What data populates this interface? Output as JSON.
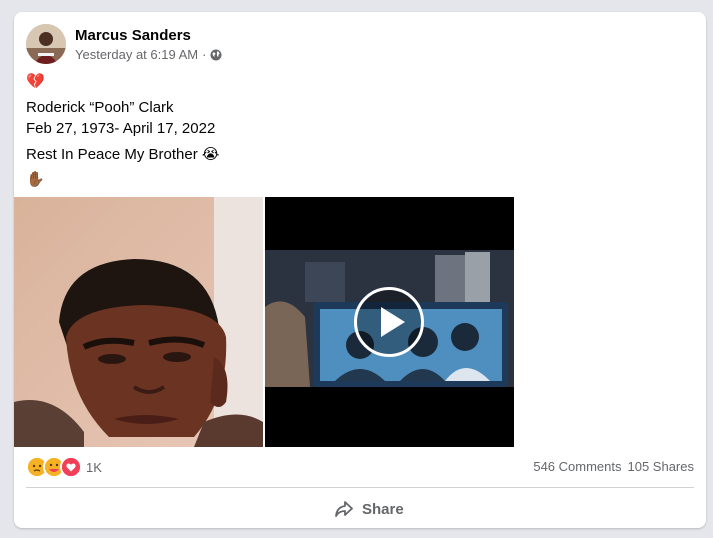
{
  "post": {
    "author": "Marcus Sanders",
    "timestamp": "Yesterday at 6:19 AM",
    "separator": "·",
    "audience_icon": "globe-icon",
    "lines": [
      "💔",
      "Roderick “Pooh” Clark",
      "Feb 27, 1973- April 17, 2022",
      "Rest In Peace My Brother 😭",
      "✋🏾"
    ]
  },
  "media": {
    "photo": "portrait-photo",
    "video": "video-thumbnail",
    "play_icon": "play-icon"
  },
  "footer": {
    "reaction_icons": [
      "care-reaction-icon",
      "wow-reaction-icon",
      "love-reaction-icon"
    ],
    "reaction_count": "1K",
    "comments": "546 Comments",
    "shares": "105 Shares",
    "share_label": "Share"
  },
  "colors": {
    "page_bg": "#e4e6eb",
    "card_bg": "#ffffff",
    "secondary_text": "#65676b",
    "love_red": "#f33e58",
    "care_yellow": "#f7b125"
  }
}
